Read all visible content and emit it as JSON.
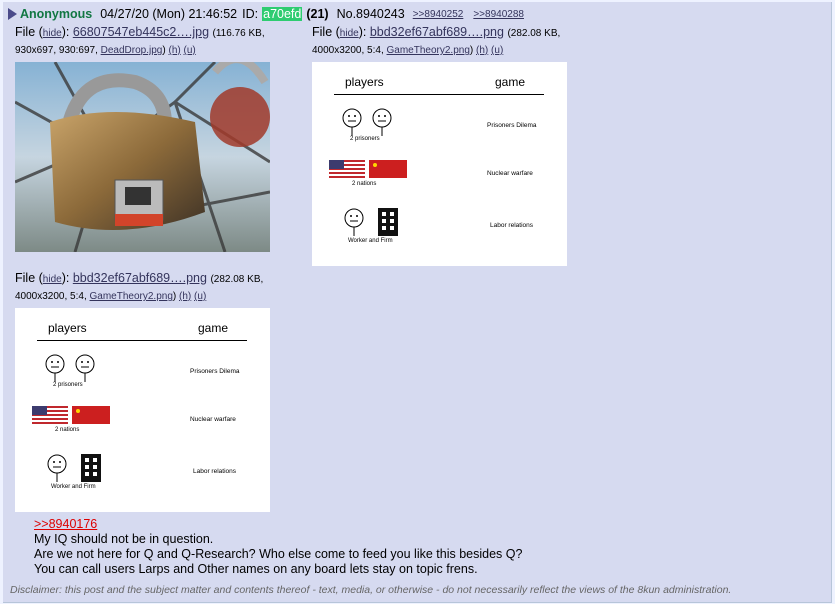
{
  "post": {
    "name": "Anonymous",
    "date": "04/27/20 (Mon) 21:46:52",
    "id_label": "ID:",
    "id_value": "a70efd",
    "count": "(21)",
    "post_number": "No.8940243",
    "backlinks": [
      ">>8940252",
      ">>8940288"
    ]
  },
  "files": [
    {
      "prefix": "File (",
      "hide": "hide",
      "sep": "):",
      "filename": "66807547eb445c2….jpg",
      "meta1": "(116.76 KB,",
      "meta2": "930x697, 930:697,",
      "orig": "DeadDrop.jpg",
      "close": ")",
      "h": "(h)",
      "u": "(u)"
    },
    {
      "prefix": "File (",
      "hide": "hide",
      "sep": "):",
      "filename": "bbd32ef67abf689….png",
      "meta1": "(282.08 KB,",
      "meta2": "4000x3200, 5:4,",
      "orig": "GameTheory2.png",
      "close": ")",
      "h": "(h)",
      "u": "(u)"
    },
    {
      "prefix": "File (",
      "hide": "hide",
      "sep": "):",
      "filename": "bbd32ef67abf689….png",
      "meta1": "(282.08 KB,",
      "meta2": "4000x3200, 5:4,",
      "orig": "GameTheory2.png",
      "close": ")",
      "h": "(h)",
      "u": "(u)"
    }
  ],
  "diagram": {
    "col_players": "players",
    "col_game": "game",
    "rows": [
      {
        "who": "2 prisoners",
        "game": "Prisoners Dilema"
      },
      {
        "who": "2 nations",
        "game": "Nuclear warfare"
      },
      {
        "who": "Worker and Firm",
        "game": "Labor relations"
      }
    ]
  },
  "body": {
    "quote_link": ">>8940176",
    "lines": [
      "My IQ should not be in question.",
      "Are we not here for Q and Q-Research? Who else come to feed you like this besides Q?",
      "You can call users Larps and Other names on any board lets stay on topic frens."
    ]
  },
  "disclaimer": "Disclaimer: this post and the subject matter and contents thereof - text, media, or otherwise - do not necessarily reflect the views of the 8kun administration.",
  "colors": {
    "post_bg": "#d6daf0",
    "name": "#117743",
    "id_bg": "#2ecc71",
    "quote": "#dd0000",
    "link": "#34345c"
  }
}
